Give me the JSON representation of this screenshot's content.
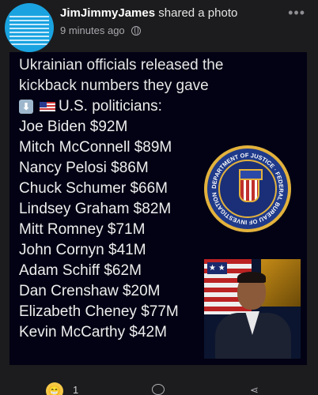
{
  "post": {
    "author": "JimJimmyJames",
    "action": "shared a photo",
    "time": "9 minutes ago",
    "privacy_icon": "globe-icon",
    "more_icon": "more-icon"
  },
  "photo": {
    "headline_line1": "Ukrainian officials released the",
    "headline_line2": "kickback numbers they gave",
    "subhead": "U.S. politicians:",
    "politicians": [
      "Joe Biden $92M",
      "Mitch McConnell $89M",
      "Nancy Pelosi $86M",
      "Chuck Schumer $66M",
      "Lindsey Graham $82M",
      "Mitt Romney $71M",
      "John Cornyn $41M",
      "Adam Schiff $62M",
      "Dan Crenshaw $20M",
      "Elizabeth Cheney $77M",
      "Kevin McCarthy $42M"
    ],
    "seal_text": "DEPARTMENT OF JUSTICE · FEDERAL BUREAU OF INVESTIGATION",
    "seal_banner": "FBI"
  },
  "actions": {
    "reaction_count": "1",
    "reaction_icon": "grinning-face-icon",
    "comment_icon": "comment-icon",
    "share_icon": "share-icon"
  },
  "colors": {
    "background": "#1c1c1e",
    "photo_bg": "#020214",
    "seal_blue": "#1f3a8a",
    "seal_gold": "#e3b23c"
  }
}
